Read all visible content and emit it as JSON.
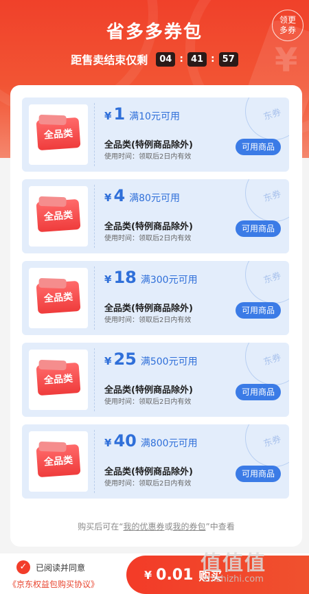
{
  "header": {
    "title": "省多多券包",
    "countdown_label": "距售卖结束仅剩",
    "hours": "04",
    "minutes": "41",
    "seconds": "57",
    "separator": ":",
    "more_button": [
      "领更",
      "多券"
    ]
  },
  "coupons": [
    {
      "symbol": "¥",
      "amount": "1",
      "condition": "满10元可用",
      "scope": "全品类(特例商品除外)",
      "validity": "使用时间：领取后2日内有效",
      "button": "可用商品",
      "ticket_label": "全品类",
      "stamp": "东券"
    },
    {
      "symbol": "¥",
      "amount": "4",
      "condition": "满80元可用",
      "scope": "全品类(特例商品除外)",
      "validity": "使用时间：领取后2日内有效",
      "button": "可用商品",
      "ticket_label": "全品类",
      "stamp": "东券"
    },
    {
      "symbol": "¥",
      "amount": "18",
      "condition": "满300元可用",
      "scope": "全品类(特例商品除外)",
      "validity": "使用时间：领取后2日内有效",
      "button": "可用商品",
      "ticket_label": "全品类",
      "stamp": "东券"
    },
    {
      "symbol": "¥",
      "amount": "25",
      "condition": "满500元可用",
      "scope": "全品类(特例商品除外)",
      "validity": "使用时间：领取后2日内有效",
      "button": "可用商品",
      "ticket_label": "全品类",
      "stamp": "东券"
    },
    {
      "symbol": "¥",
      "amount": "40",
      "condition": "满800元可用",
      "scope": "全品类(特例商品除外)",
      "validity": "使用时间：领取后2日内有效",
      "button": "可用商品",
      "ticket_label": "全品类",
      "stamp": "东券"
    }
  ],
  "footnote": {
    "prefix": "购买后可在“",
    "link1": "我的优惠券",
    "middle": "或",
    "link2": "我的券包",
    "suffix": "”中查看"
  },
  "bottom": {
    "agree_text": "已阅读并同意",
    "protocol_link": "《京东权益包购买协议》",
    "pay_symbol": "¥",
    "pay_price": "0.01",
    "pay_label": "购买"
  },
  "watermark": {
    "main": "值值值",
    "url": "zhizhizhi.com"
  },
  "colors": {
    "brand_red": "#f0412a",
    "coupon_blue": "#2f6fd9",
    "coupon_bg": "#e3edfb",
    "button_blue": "#3b7be6"
  }
}
